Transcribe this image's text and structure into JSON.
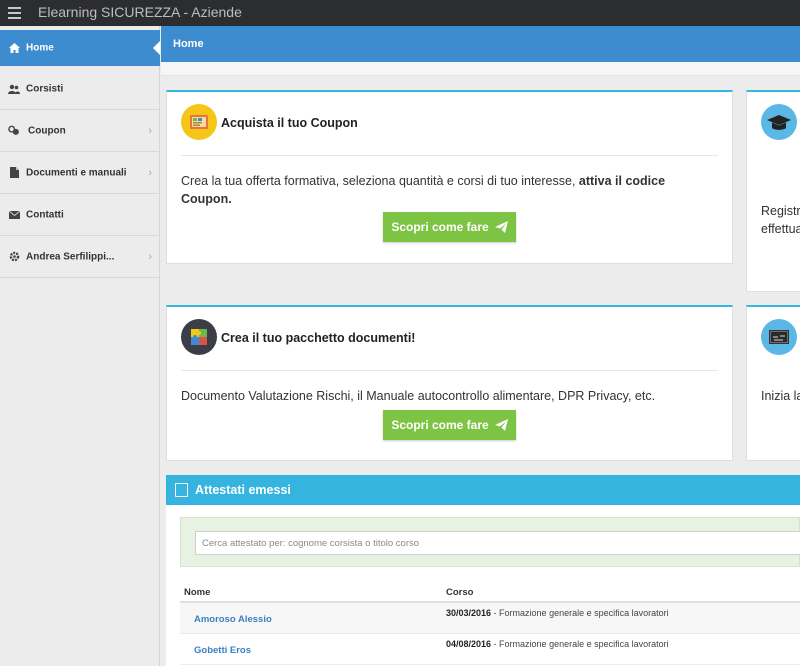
{
  "app": {
    "title": "Elearning SICUREZZA - Aziende"
  },
  "sidebar": {
    "items": [
      {
        "label": "Home",
        "icon": "home-icon"
      },
      {
        "label": "Corsisti",
        "icon": "users-icon"
      },
      {
        "label": "Coupon",
        "icon": "coins-icon"
      },
      {
        "label": "Documenti e manuali",
        "icon": "document-icon"
      },
      {
        "label": "Contatti",
        "icon": "envelope-icon"
      },
      {
        "label": "Andrea Serfilippi...",
        "icon": "gear-icon"
      }
    ]
  },
  "header": {
    "title": "Home"
  },
  "cards": {
    "coupon": {
      "title": "Acquista il tuo Coupon",
      "text_pre": "Crea la tua offerta formativa, seleziona quantità e corsi di tuo interesse, ",
      "text_bold": "attiva il codice Coupon.",
      "button": "Scopri come fare"
    },
    "documenti": {
      "title": "Crea il tuo pacchetto documenti!",
      "text": "Documento Valutazione Rischi, il Manuale autocontrollo alimentare, DPR Privacy, etc.",
      "button": "Scopri come fare"
    },
    "right_top": {
      "line1": "Registr",
      "line2": "effettua"
    },
    "right_bottom": {
      "line1": "Inizia la"
    }
  },
  "attestati": {
    "title": "Attestati emessi",
    "search_placeholder": "Cerca attestato per: cognome corsista o titolo corso",
    "columns": [
      "Nome",
      "Corso"
    ],
    "rows": [
      {
        "name": "Amoroso Alessio",
        "date": "30/03/2016",
        "course": " - Formazione generale e specifica lavoratori"
      },
      {
        "name": "Gobetti Eros",
        "date": "04/08/2016",
        "course": " - Formazione generale e specifica lavoratori"
      }
    ]
  },
  "colors": {
    "primary": "#3d8ccf",
    "accent": "#34b4de",
    "button": "#7dc444",
    "topbar": "#2c2d2f"
  }
}
